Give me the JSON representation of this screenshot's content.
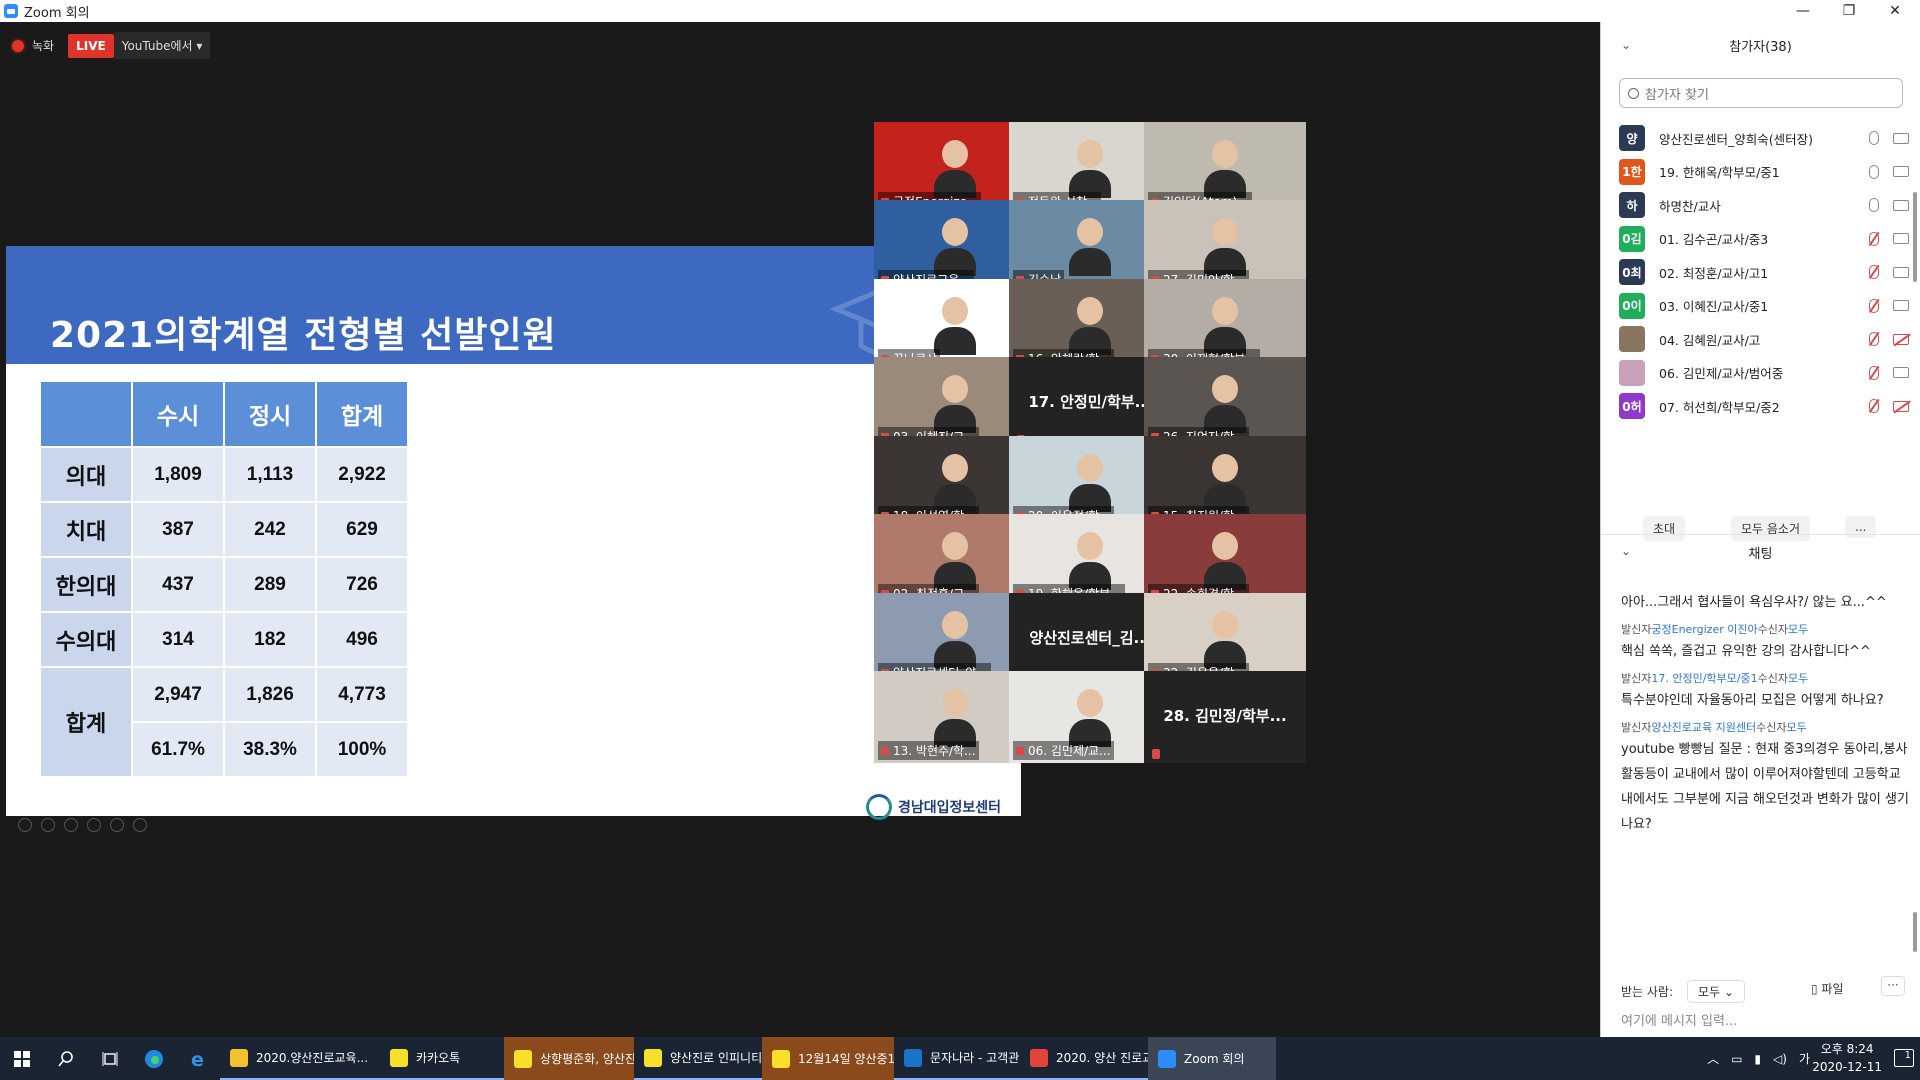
{
  "window": {
    "title": "Zoom 회의"
  },
  "recording": {
    "label": "녹화",
    "live": "LIVE",
    "stream": "YouTube에서"
  },
  "slide": {
    "title": "2021의학계열 전형별 선발인원",
    "headers": [
      "",
      "수시",
      "정시",
      "합계"
    ],
    "rows": [
      {
        "label": "의대",
        "values": [
          "1,809",
          "1,113",
          "2,922"
        ]
      },
      {
        "label": "치대",
        "values": [
          "387",
          "242",
          "629"
        ]
      },
      {
        "label": "한의대",
        "values": [
          "437",
          "289",
          "726"
        ]
      },
      {
        "label": "수의대",
        "values": [
          "314",
          "182",
          "496"
        ]
      }
    ],
    "total": {
      "label": "합계",
      "row1": [
        "2,947",
        "1,826",
        "4,773"
      ],
      "row2": [
        "61.7%",
        "38.3%",
        "100%"
      ]
    },
    "logo": "경남대입정보센터"
  },
  "videos": [
    {
      "name": "궁정Energize...",
      "bg": "#c4221c",
      "type": "video"
    },
    {
      "name": "정동완 서창...",
      "bg": "#d9d6cf",
      "type": "video"
    },
    {
      "name": "김인덕(Atom)...",
      "bg": "#bfbab0",
      "type": "video",
      "active": true
    },
    {
      "name": "양산진로교육...",
      "bg": "#2f5f9e",
      "type": "video"
    },
    {
      "name": "김순남",
      "bg": "#6b8aa3",
      "type": "video"
    },
    {
      "name": "27. 김미아/학...",
      "bg": "#c9c2b8",
      "type": "video"
    },
    {
      "name": "꿈나르샤",
      "bg": "#ffffff",
      "type": "video"
    },
    {
      "name": "16. 안혜란/학...",
      "bg": "#6a5f56",
      "type": "video"
    },
    {
      "name": "30. 이재혁/학부...",
      "bg": "#b3ada5",
      "type": "video"
    },
    {
      "name": "03. 이혜진/교...",
      "bg": "#9a8a7c",
      "type": "video"
    },
    {
      "name": "17. 안정민/학부...",
      "bg": "#232323",
      "type": "nameonly"
    },
    {
      "name": "26. 지언자/학...",
      "bg": "#5a5550",
      "type": "video"
    },
    {
      "name": "18. 이선영/학...",
      "bg": "#3b3633",
      "type": "video"
    },
    {
      "name": "20. 이은정/학...",
      "bg": "#c8d6dc",
      "type": "video"
    },
    {
      "name": "15. 최지원/학...",
      "bg": "#3a3533",
      "type": "video"
    },
    {
      "name": "02. 최정훈/교...",
      "bg": "#b07a6a",
      "type": "video"
    },
    {
      "name": "19. 한해옥/학부...",
      "bg": "#e8e4e0",
      "type": "video"
    },
    {
      "name": "22. 송희경/학...",
      "bg": "#8a3b3b",
      "type": "video"
    },
    {
      "name": "양산진로센터_양...",
      "bg": "#8c9bb0",
      "type": "video"
    },
    {
      "name": "양산진로센터_김...",
      "bg": "#232323",
      "type": "nameonly"
    },
    {
      "name": "32. 김은옥/학...",
      "bg": "#d8d0c4",
      "type": "video"
    },
    {
      "name": "13. 박현주/학...",
      "bg": "#d2cbc4",
      "type": "video"
    },
    {
      "name": "06. 김민제/교...",
      "bg": "#e8e6e2",
      "type": "video"
    },
    {
      "name": "28. 김민정/학부...",
      "bg": "#232323",
      "type": "nameonly"
    }
  ],
  "participants": {
    "title": "참가자(38)",
    "search_placeholder": "참가자 찾기",
    "list": [
      {
        "avatar": "양",
        "color": "#2b3a55",
        "name": "양산진로센터_양희숙(센터장)",
        "mic": "on",
        "cam": "on"
      },
      {
        "avatar": "1한",
        "color": "#e0561b",
        "name": "19. 한해옥/학부모/중1",
        "mic": "on",
        "cam": "on"
      },
      {
        "avatar": "하",
        "color": "#2b3a55",
        "name": "하명찬/교사",
        "mic": "on",
        "cam": "on"
      },
      {
        "avatar": "0김",
        "color": "#1fae5a",
        "name": "01. 김수곤/교사/중3",
        "mic": "muted",
        "cam": "on"
      },
      {
        "avatar": "0최",
        "color": "#2b3a55",
        "name": "02. 최정훈/교사/고1",
        "mic": "muted",
        "cam": "on"
      },
      {
        "avatar": "0이",
        "color": "#1fae5a",
        "name": "03. 이혜진/교사/중1",
        "mic": "muted",
        "cam": "on"
      },
      {
        "avatar": "",
        "color": "#8a7560",
        "name": "04. 김혜원/교사/고",
        "mic": "muted",
        "cam": "off"
      },
      {
        "avatar": "",
        "color": "#c9a0b8",
        "name": "06. 김민제/교사/범어중",
        "mic": "muted",
        "cam": "on"
      },
      {
        "avatar": "0허",
        "color": "#8e3bc9",
        "name": "07. 허선희/학부모/중2",
        "mic": "muted",
        "cam": "off"
      }
    ],
    "invite": "초대",
    "mute_all": "모두 음소거",
    "more": "..."
  },
  "chat": {
    "title": "채팅",
    "messages": [
      {
        "sender": "",
        "text": "아아...그래서 협사들이 욕심우사?/ 않는 요...^^"
      },
      {
        "sender_pre": "발신자",
        "sender": "궁정Energizer 이진아",
        "to_pre": "수신자",
        "to": "모두",
        "text": "핵심 쏙쏙, 즐겁고 유익한 강의 감사합니다^^"
      },
      {
        "sender_pre": "발신자",
        "sender": "17. 안정민/학부모/중1",
        "to_pre": "수신자",
        "to": "모두",
        "text": "특수분야인데 자율동아리 모집은 어떻게 하나요?"
      },
      {
        "sender_pre": "발신자",
        "sender": "양산진로교육 지원센터",
        "to_pre": "수신자",
        "to": "모두",
        "text": "youtube 빵빵님 질문 : 현재 중3의경우 동아리,봉사활동등이 교내에서 많이 이루어져야할텐데 고등학교내에서도 그부분에 지금 해오던것과 변화가 많이 생기나요?"
      }
    ],
    "to_label": "받는 사람:",
    "to_value": "모두",
    "file": "파일",
    "more": "···",
    "placeholder": "여기에 메시지 입력..."
  },
  "taskbar": {
    "items": [
      {
        "label": "2020.양산진로교육...",
        "color": "#f2c12e",
        "style": "open"
      },
      {
        "label": "카카오톡",
        "color": "#f7e02a",
        "style": "open"
      },
      {
        "label": "상향평준화, 양산진...",
        "color": "#f7e02a",
        "style": "orange"
      },
      {
        "label": "양산진로 인피니티...",
        "color": "#f7e02a",
        "style": "open"
      },
      {
        "label": "12월14일 양산중1...",
        "color": "#f7e02a",
        "style": "orange"
      },
      {
        "label": "문자나라 - 고객관...",
        "color": "#1a73c8",
        "style": "open"
      },
      {
        "label": "2020. 양산 진로교...",
        "color": "#e2443a",
        "style": "open"
      },
      {
        "label": "Zoom 회의",
        "color": "#2d8cff",
        "style": "active"
      }
    ],
    "ime": "가",
    "time": "오후 8:24",
    "date": "2020-12-11",
    "notif": "1"
  }
}
